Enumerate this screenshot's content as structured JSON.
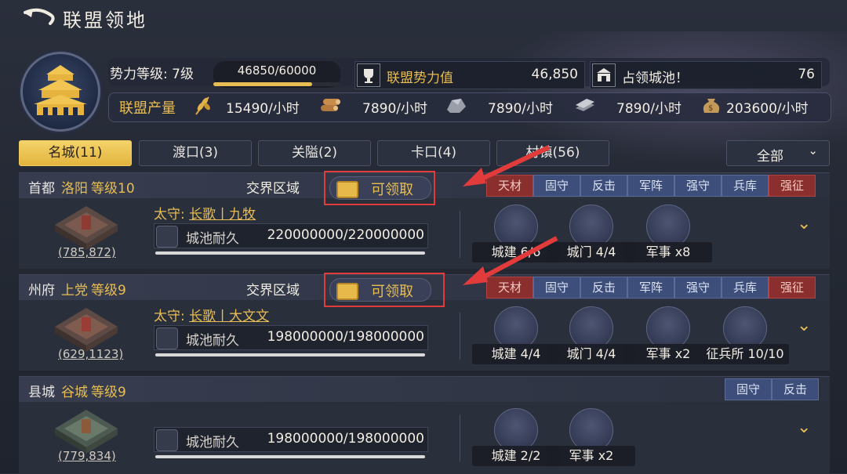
{
  "header": {
    "title": "联盟领地"
  },
  "summary": {
    "level_label": "势力等级: 7级",
    "exp_text": "46850/60000",
    "exp_progress": 0.78,
    "power_label": "联盟势力值",
    "power_value": "46,850",
    "occupy_label": "占领城池！",
    "occupy_value": "76",
    "production_label": "联盟产量",
    "production": [
      {
        "icon": "wheat-icon",
        "value": "15490/小时"
      },
      {
        "icon": "wood-icon",
        "value": "7890/小时"
      },
      {
        "icon": "stone-icon",
        "value": "7890/小时"
      },
      {
        "icon": "iron-icon",
        "value": "7890/小时"
      },
      {
        "icon": "coin-bag-icon",
        "value": "203600/小时"
      }
    ]
  },
  "tabs": [
    {
      "label": "名城(11)",
      "active": true
    },
    {
      "label": "渡口(3)",
      "active": false
    },
    {
      "label": "关隘(2)",
      "active": false
    },
    {
      "label": "卡口(4)",
      "active": false
    },
    {
      "label": "村镇(56)",
      "active": false
    }
  ],
  "filter": {
    "label": "全部"
  },
  "cards": [
    {
      "type": "首都",
      "city": "洛阳",
      "level": "等级10",
      "region": "交界区域",
      "claim_label": "可领取",
      "tags": [
        "天材",
        "固守",
        "反击",
        "军阵",
        "强守",
        "兵库",
        "强征"
      ],
      "coords": "(785,872)",
      "governor_prefix": "太守: ",
      "governor": "长歌丨九牧",
      "durability_label": "城池耐久",
      "durability": "220000000/220000000",
      "buildings": [
        "城建 6/6",
        "城门 4/4",
        "军事 x8"
      ]
    },
    {
      "type": "州府",
      "city": "上党",
      "level": "等级9",
      "region": "交界区域",
      "claim_label": "可领取",
      "tags": [
        "天材",
        "固守",
        "反击",
        "军阵",
        "强守",
        "兵库",
        "强征"
      ],
      "coords": "(629,1123)",
      "governor_prefix": "太守: ",
      "governor": "长歌丨大文文",
      "durability_label": "城池耐久",
      "durability": "198000000/198000000",
      "buildings": [
        "城建 4/4",
        "城门 4/4",
        "军事 x2",
        "征兵所 10/10"
      ]
    },
    {
      "type": "县城",
      "city": "谷城",
      "level": "等级9",
      "tags": [
        "固守",
        "反击"
      ],
      "coords": "(779,834)",
      "durability_label": "城池耐久",
      "durability": "198000000/198000000",
      "buildings": [
        "城建 2/2",
        "军事 x2"
      ]
    }
  ],
  "colors": {
    "gold": "#e8bd52",
    "tag_blue": "#3d4e7a",
    "tag_red": "#8a2e2e",
    "highlight": "#e23b3b"
  }
}
